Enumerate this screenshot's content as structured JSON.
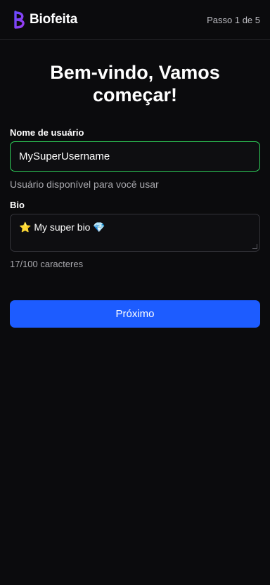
{
  "brand": {
    "name": "Biofeita",
    "logo_icon": "biofeita-logo-icon"
  },
  "step": {
    "text": "Passo 1 de 5"
  },
  "title": "Bem-vindo, Vamos começar!",
  "username": {
    "label": "Nome de usuário",
    "value": "MySuperUsername",
    "status": "Usuário disponível para você usar",
    "status_color": "#2fd05a"
  },
  "bio": {
    "label": "Bio",
    "value": "⭐ My super bio 💎",
    "counter": "17/100 caracteres"
  },
  "next_button": {
    "label": "Próximo",
    "color": "#1d5cff"
  }
}
